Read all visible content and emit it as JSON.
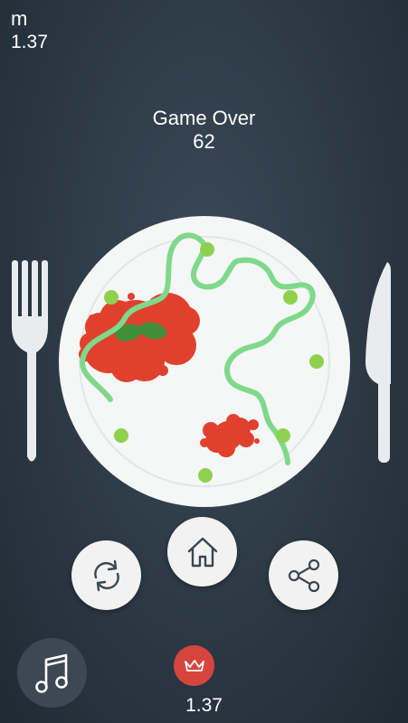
{
  "hud": {
    "unit": "m",
    "value": "1.37"
  },
  "result": {
    "title": "Game Over",
    "score": "62"
  },
  "buttons": {
    "home": {
      "icon": "home-icon"
    },
    "restart": {
      "icon": "restart-icon"
    },
    "share": {
      "icon": "share-icon"
    },
    "music": {
      "icon": "music-note-icon"
    }
  },
  "best": {
    "icon": "crown-icon",
    "value": "1.37"
  },
  "colors": {
    "background": "#2c3945",
    "plate": "#f5f5f5",
    "noodle": "#7fd98a",
    "sauce": "#e0412d",
    "leaf": "#3f8f3a",
    "pea": "#8fd14f",
    "crown_badge": "#d6453d"
  }
}
